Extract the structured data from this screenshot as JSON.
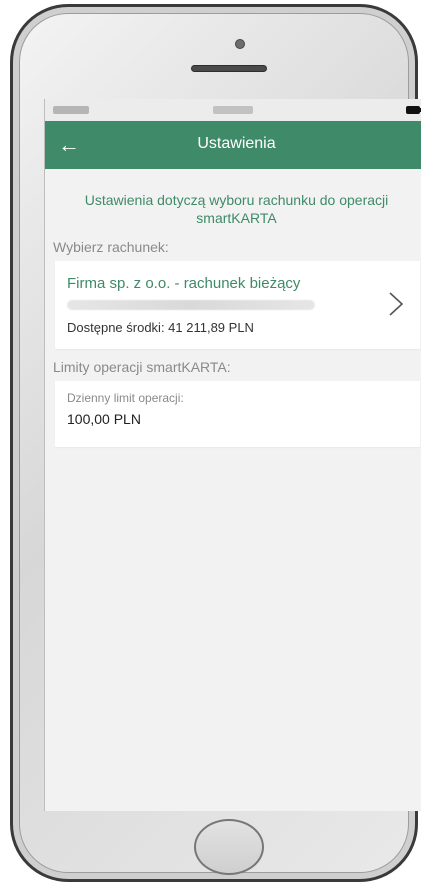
{
  "header": {
    "back_icon": "arrow-left-icon",
    "title": "Ustawienia"
  },
  "intro": {
    "text": "Ustawienia dotyczą wyboru rachunku do operacji smartKARTA"
  },
  "account_section": {
    "label": "Wybierz rachunek:",
    "account": {
      "name": "Firma sp. z o.o. - rachunek bieżący",
      "funds_label": "Dostępne środki: 41 211,89 PLN",
      "chevron_icon": "chevron-right-icon"
    }
  },
  "limits_section": {
    "label": "Limity operacji smartKARTA:",
    "daily_limit_label": "Dzienny limit operacji:",
    "daily_limit_value": "100,00 PLN"
  },
  "colors": {
    "brand_green": "#3f8a68",
    "background": "#f2f2f2"
  }
}
